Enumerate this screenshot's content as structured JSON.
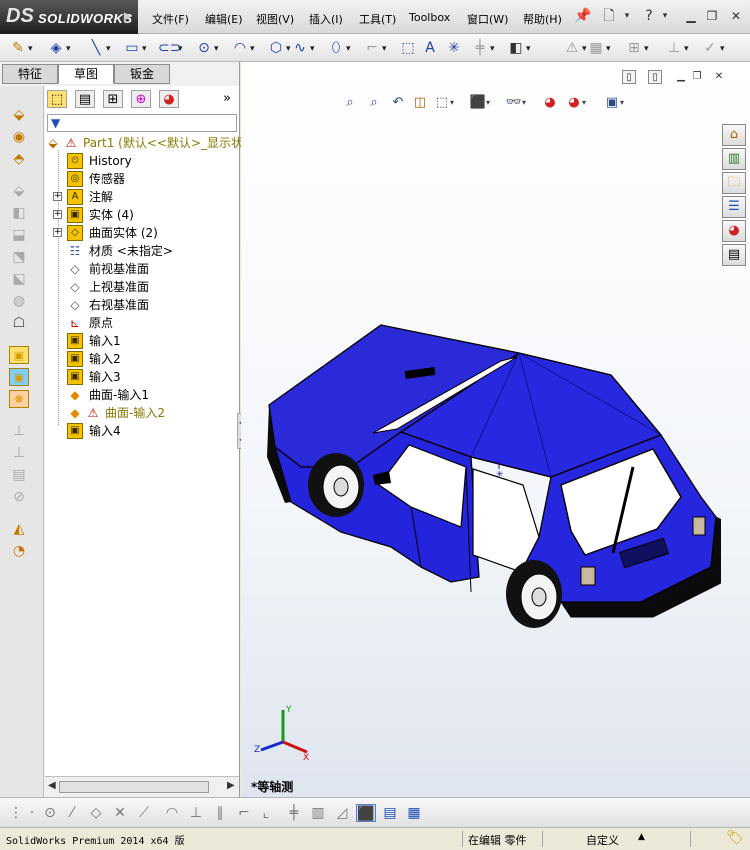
{
  "app": {
    "brand_mark": "DS",
    "brand_name": "SOLIDWORKS"
  },
  "menu": [
    "文件(F)",
    "编辑(E)",
    "视图(V)",
    "插入(I)",
    "工具(T)",
    "Toolbox",
    "窗口(W)",
    "帮助(H)"
  ],
  "tabs": [
    {
      "label": "特征",
      "active": false
    },
    {
      "label": "草图",
      "active": true
    },
    {
      "label": "钣金",
      "active": false
    }
  ],
  "feature_tree": {
    "root": {
      "label": "Part1",
      "config": "(默认<<默认>_显示状"
    },
    "items": [
      {
        "label": "History",
        "icon": "history-icon",
        "expandable": false,
        "warn": false
      },
      {
        "label": "传感器",
        "icon": "sensor-icon",
        "expandable": false,
        "warn": false
      },
      {
        "label": "注解",
        "icon": "annotation-icon",
        "expandable": true,
        "warn": false
      },
      {
        "label": "实体 (4)",
        "icon": "solid-body-icon",
        "expandable": true,
        "warn": false
      },
      {
        "label": "曲面实体 (2)",
        "icon": "surface-body-icon",
        "expandable": true,
        "warn": false
      },
      {
        "label": "材质 <未指定>",
        "icon": "material-icon",
        "expandable": false,
        "warn": false
      },
      {
        "label": "前视基准面",
        "icon": "plane-icon",
        "expandable": false,
        "warn": false
      },
      {
        "label": "上视基准面",
        "icon": "plane-icon",
        "expandable": false,
        "warn": false
      },
      {
        "label": "右视基准面",
        "icon": "plane-icon",
        "expandable": false,
        "warn": false
      },
      {
        "label": "原点",
        "icon": "origin-icon",
        "expandable": false,
        "warn": false
      },
      {
        "label": "输入1",
        "icon": "import-icon",
        "expandable": false,
        "warn": false
      },
      {
        "label": "输入2",
        "icon": "import-icon",
        "expandable": false,
        "warn": false
      },
      {
        "label": "输入3",
        "icon": "import-icon",
        "expandable": false,
        "warn": false
      },
      {
        "label": "曲面-输入1",
        "icon": "surface-import-icon",
        "expandable": false,
        "warn": false
      },
      {
        "label": "曲面-输入2",
        "icon": "surface-import-icon",
        "expandable": false,
        "warn": true
      },
      {
        "label": "输入4",
        "icon": "import-icon",
        "expandable": false,
        "warn": false
      }
    ]
  },
  "viewport": {
    "view_name": "*等轴测",
    "model_color": "#2020e0",
    "triad": {
      "x": "X",
      "y": "Y",
      "z": "Z"
    }
  },
  "status": {
    "product": "SolidWorks Premium 2014 x64 版",
    "mode": "在编辑 零件",
    "units": "自定义",
    "units_arrow": "▲"
  }
}
